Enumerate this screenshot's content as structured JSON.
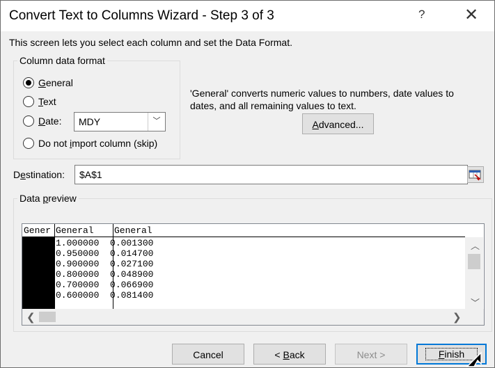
{
  "window": {
    "title": "Convert Text to Columns Wizard - Step 3 of 3",
    "help_glyph": "?",
    "close_glyph": "✕"
  },
  "description": "This screen lets you select each column and set the Data Format.",
  "format_group": {
    "title": "Column data format",
    "options": [
      {
        "label_underline": "G",
        "label_rest": "eneral",
        "checked": true
      },
      {
        "label_underline": "T",
        "label_rest": "ext",
        "checked": false
      },
      {
        "label_underline": "D",
        "label_rest": "ate:",
        "checked": false
      },
      {
        "label_before": "Do not ",
        "label_underline": "i",
        "label_rest": "mport column (skip)",
        "checked": false
      }
    ],
    "date_format": "MDY"
  },
  "info_text": "'General' converts numeric values to numbers, date values to dates, and all remaining values to text.",
  "advanced_button": {
    "label_underline": "A",
    "label_rest": "dvanced..."
  },
  "destination": {
    "label_before": "D",
    "label_underline": "e",
    "label_rest": "stination:",
    "value": "$A$1"
  },
  "preview": {
    "title_before": "Data ",
    "title_underline": "p",
    "title_rest": "review",
    "headers": [
      "Gener",
      "General",
      "General"
    ],
    "rows": [
      [
        "",
        "1.000000",
        "0.001300"
      ],
      [
        "",
        "0.950000",
        "0.014700"
      ],
      [
        "",
        "0.900000",
        "0.027100"
      ],
      [
        "",
        "0.800000",
        "0.048900"
      ],
      [
        "",
        "0.700000",
        "0.066900"
      ],
      [
        "",
        "0.600000",
        "0.081400"
      ]
    ]
  },
  "buttons": {
    "cancel": "Cancel",
    "back_before": "< ",
    "back_underline": "B",
    "back_rest": "ack",
    "next": "Next >",
    "finish_underline": "F",
    "finish_rest": "inish"
  }
}
